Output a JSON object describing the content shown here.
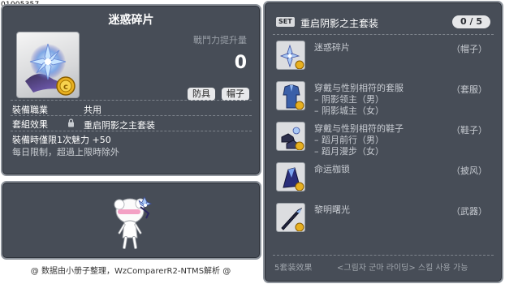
{
  "item_id": "01005357",
  "item": {
    "title": "迷惑碎片",
    "power_label": "戰鬥力提升量",
    "power_value": "0",
    "tags": [
      "防具",
      "帽子"
    ],
    "job_label": "裝備職業",
    "job_value": "共用",
    "set_label": "套組效果",
    "set_value": "重启阴影之主套装",
    "limit_line": "裝備時僅限1次魅力 +50",
    "limit_note": "每日限制，超過上限時除外"
  },
  "footer": "@ 数据由小册子整理，WzComparerR2-NTMS解析 @",
  "set": {
    "badge": "SET",
    "name": "重启阴影之主套装",
    "count": "0 / 5",
    "items": [
      {
        "name": "迷惑碎片",
        "category": "（帽子）",
        "subs": []
      },
      {
        "name": "穿戴与性别相符的套服",
        "category": "（套服）",
        "subs": [
          "– 阴影领主（男）",
          "– 阴影城主（女）"
        ]
      },
      {
        "name": "穿戴与性别相符的鞋子",
        "category": "（鞋子）",
        "subs": [
          "– 蹈月前行（男）",
          "– 蹈月漫步（女）"
        ]
      },
      {
        "name": "命运枷锁",
        "category": "（披风）",
        "subs": []
      },
      {
        "name": "黎明曙光",
        "category": "（武器）",
        "subs": []
      }
    ],
    "effect_label": "5套装效果",
    "effect_value": "<그림자 군마 라이딩> 스킬 사용 가능"
  }
}
